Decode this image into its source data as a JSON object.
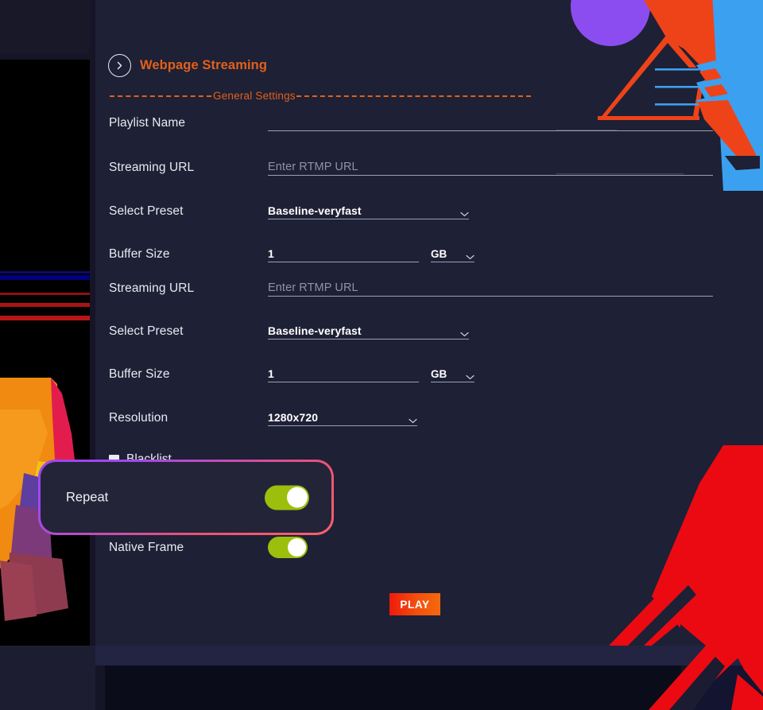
{
  "header": {
    "back_icon": "chevron-right-circle-icon",
    "title": "Webpage Streaming"
  },
  "section": {
    "label": "General Settings"
  },
  "form": {
    "rows": [
      {
        "label": "Playlist Name",
        "value": "",
        "placeholder": ""
      },
      {
        "label": "Streaming URL",
        "value": "",
        "placeholder": "Enter RTMP URL"
      },
      {
        "label": "Select Preset",
        "value": "Baseline-veryfast",
        "placeholder": ""
      },
      {
        "label": "Buffer Size",
        "value": "1",
        "unit": "GB"
      },
      {
        "label": "Streaming URL",
        "value": "",
        "placeholder": "Enter RTMP URL"
      },
      {
        "label": "Select Preset",
        "value": "Baseline-veryfast",
        "placeholder": ""
      },
      {
        "label": "Buffer Size",
        "value": "1",
        "unit": "GB"
      },
      {
        "label": "Resolution",
        "value": "1280x720",
        "placeholder": ""
      }
    ],
    "blacklist": {
      "label": "Blacklist",
      "checked": true
    },
    "native_frame": {
      "label": "Native Frame",
      "on": true
    }
  },
  "callout": {
    "label": "Repeat",
    "toggle_on": true
  },
  "actions": {
    "play_label": "PLAY"
  },
  "colors": {
    "panel_bg": "#1E2035",
    "accent_orange": "#E2601B",
    "toggle_green": "#9BBF0C",
    "callout_border_start": "#9B46F5",
    "callout_border_end": "#F9606B",
    "play_gradient_start": "#EE1B0C",
    "play_gradient_end": "#F4690E",
    "underline": "#9AA1B8"
  }
}
